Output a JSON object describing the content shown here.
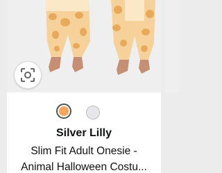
{
  "product": {
    "brand": "Silver Lilly",
    "title_line1": "Slim Fit Adult Onesie -",
    "title_line2": "Animal Halloween Costu..."
  },
  "swatches": [
    {
      "name": "Giraffe",
      "color": "#f5a65b",
      "selected": true
    },
    {
      "name": "Grey",
      "color": "#e6e6eb",
      "selected": false
    }
  ],
  "icons": {
    "lens": "visual-search-icon"
  },
  "colors": {
    "giraffe_base": "#f6d29a",
    "giraffe_spot": "#e9a95a",
    "skin": "#c68e72"
  }
}
